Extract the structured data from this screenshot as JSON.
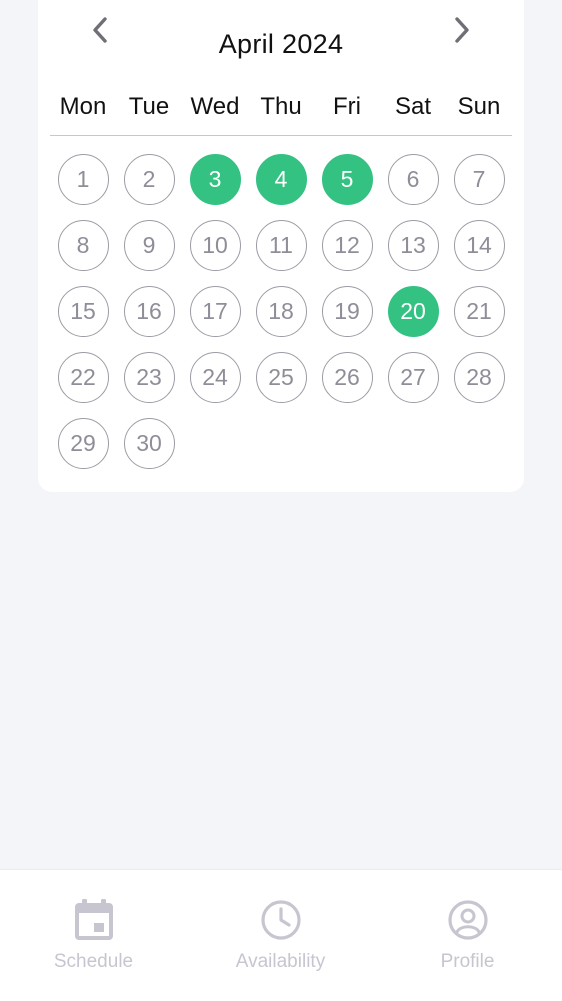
{
  "calendar": {
    "title": "April 2024",
    "weekdays": [
      "Mon",
      "Tue",
      "Wed",
      "Thu",
      "Fri",
      "Sat",
      "Sun"
    ],
    "start_offset": 0,
    "days": [
      "1",
      "2",
      "3",
      "4",
      "5",
      "6",
      "7",
      "8",
      "9",
      "10",
      "11",
      "12",
      "13",
      "14",
      "15",
      "16",
      "17",
      "18",
      "19",
      "20",
      "21",
      "22",
      "23",
      "24",
      "25",
      "26",
      "27",
      "28",
      "29",
      "30"
    ],
    "selected_days": [
      "3",
      "4",
      "5",
      "20"
    ],
    "icons": {
      "prev": "chevron-left-icon",
      "next": "chevron-right-icon"
    }
  },
  "tabs": [
    {
      "label": "Schedule",
      "icon": "calendar-icon"
    },
    {
      "label": "Availability",
      "icon": "clock-icon"
    },
    {
      "label": "Profile",
      "icon": "user-circle-icon"
    }
  ],
  "colors": {
    "selected": "#33c282",
    "day_outline": "#9d9ba6",
    "background": "#f4f5f9",
    "tab_inactive": "#c7c5cf"
  }
}
